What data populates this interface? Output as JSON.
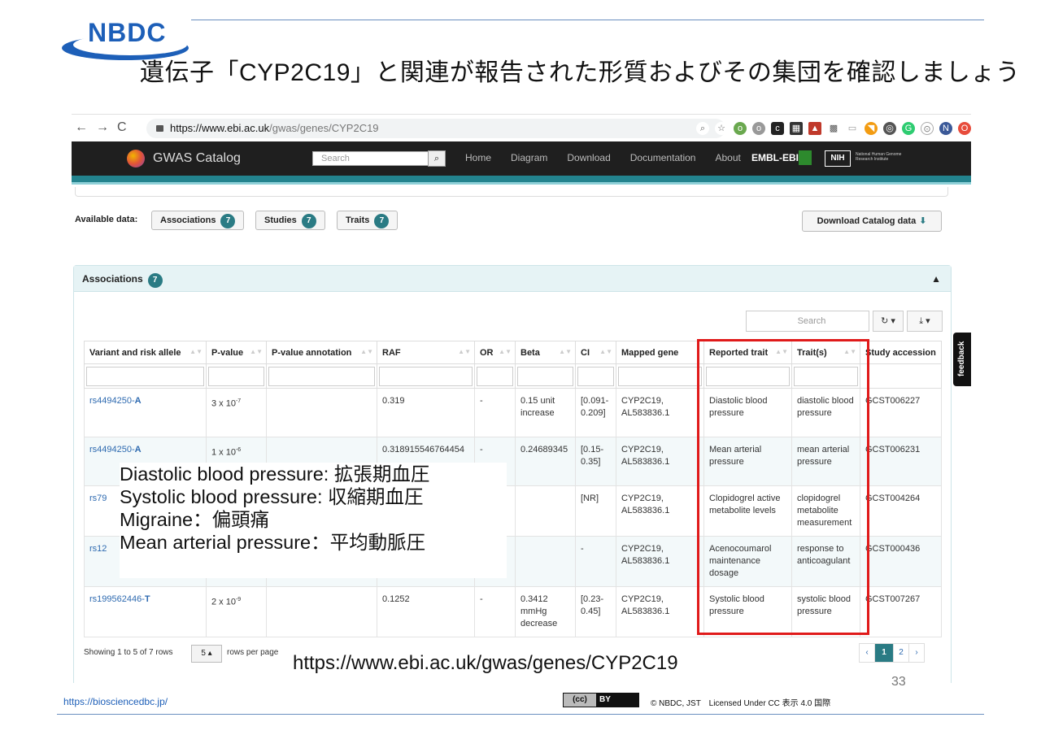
{
  "slide": {
    "logo": "NBDC",
    "title": "遺伝子「CYP2C19」と関連が報告された形質およびその集団を確認しましょう",
    "footer_url": "https://biosciencedbc.jp/",
    "cc_left": "(cc)",
    "cc_right": "BY",
    "license": "© NBDC, JST　Licensed Under CC 表示 4.0 国際",
    "page_number": "33",
    "url_caption": "https://www.ebi.ac.uk/gwas/genes/CYP2C19"
  },
  "browser": {
    "url_host": "https://www.ebi.ac.uk",
    "url_path": "/gwas/genes/CYP2C19"
  },
  "gwas_nav": {
    "brand": "GWAS Catalog",
    "search_placeholder": "Search",
    "links": [
      "Home",
      "Diagram",
      "Download",
      "Documentation",
      "About"
    ],
    "embl": "EMBL-EBI",
    "nih": "NIH",
    "nih_text": "National Human Genome Research Institute"
  },
  "available": {
    "label": "Available data:",
    "buttons": [
      {
        "label": "Associations",
        "count": "7"
      },
      {
        "label": "Studies",
        "count": "7"
      },
      {
        "label": "Traits",
        "count": "7"
      }
    ],
    "download_label": "Download Catalog data"
  },
  "associations": {
    "title": "Associations",
    "count": "7",
    "search_placeholder": "Search",
    "columns": [
      "Variant and risk allele",
      "P-value",
      "P-value annotation",
      "RAF",
      "OR",
      "Beta",
      "CI",
      "Mapped gene",
      "Reported trait",
      "Trait(s)",
      "Study accession"
    ],
    "rows": [
      {
        "rs": "rs4494250-",
        "allele": "A",
        "p_mant": "3 x 10",
        "p_exp": "-7",
        "p_annot": "",
        "raf": "0.319",
        "or": "-",
        "beta": "0.15 unit increase",
        "ci": "[0.091-0.209]",
        "gene": "CYP2C19, AL583836.1",
        "reported": "Diastolic blood pressure",
        "traits": "diastolic blood pressure",
        "study": "GCST006227"
      },
      {
        "rs": "rs4494250-",
        "allele": "A",
        "p_mant": "1 x 10",
        "p_exp": "-6",
        "p_annot": "",
        "raf": "0.318915546764454",
        "or": "-",
        "beta": "0.24689345",
        "ci": "[0.15-0.35]",
        "gene": "CYP2C19, AL583836.1",
        "reported": "Mean arterial pressure",
        "traits": "mean arterial pressure",
        "study": "GCST006231"
      },
      {
        "rs": "rs79",
        "allele": "",
        "p_mant": "",
        "p_exp": "",
        "p_annot": "",
        "raf": "",
        "or": "",
        "beta": "",
        "ci": "[NR]",
        "gene": "CYP2C19, AL583836.1",
        "reported": "Clopidogrel active metabolite levels",
        "traits": "clopidogrel metabolite measurement",
        "study": "GCST004264"
      },
      {
        "rs": "rs12",
        "allele": "",
        "p_mant": "",
        "p_exp": "",
        "p_annot": "",
        "raf": "",
        "or": "",
        "beta": "",
        "ci": "-",
        "gene": "CYP2C19, AL583836.1",
        "reported": "Acenocoumarol maintenance dosage",
        "traits": "response to anticoagulant",
        "study": "GCST000436"
      },
      {
        "rs": "rs199562446-",
        "allele": "T",
        "p_mant": "2 x 10",
        "p_exp": "-9",
        "p_annot": "",
        "raf": "0.1252",
        "or": "-",
        "beta": "0.3412 mmHg decrease",
        "ci": "[0.23-0.45]",
        "gene": "CYP2C19, AL583836.1",
        "reported": "Systolic blood pressure",
        "traits": "systolic blood pressure",
        "study": "GCST007267"
      }
    ],
    "showing": "Showing 1 to 5 of 7 rows",
    "rows_per_page_value": "5",
    "rows_per_page_label": "rows per page",
    "pages": [
      "‹",
      "1",
      "2",
      "›"
    ]
  },
  "overlay": [
    "Diastolic blood pressure: 拡張期血圧",
    "Systolic blood pressure: 収縮期血圧",
    "Migraine：偏頭痛",
    "Mean arterial pressure：平均動脈圧"
  ],
  "feedback": "feedback"
}
